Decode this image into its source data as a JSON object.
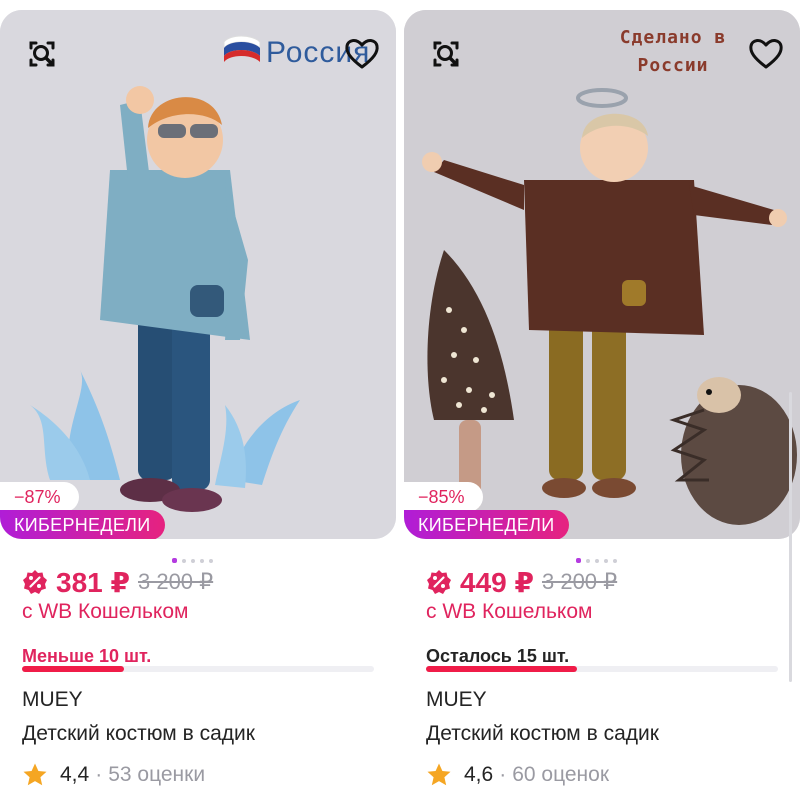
{
  "products": [
    {
      "discount": "−87%",
      "promo_label": "КИБЕРНЕДЕЛИ",
      "origin_logo": "Россия",
      "price": "381 ₽",
      "old_price": "3 200 ₽",
      "wallet_text": "с WB Кошельком",
      "stock_text": "Меньше 10 шт.",
      "stock_level": 0.29,
      "brand": "MUEY",
      "name": "Детский костюм в садик",
      "rating": "4,4",
      "reviews": "53 оценки",
      "gallery_total": 5,
      "gallery_active": 0
    },
    {
      "discount": "−85%",
      "promo_label": "КИБЕРНЕДЕЛИ",
      "origin_text": "Сделано в России",
      "origin_line1": "Сделано в",
      "origin_line2": "России",
      "price": "449 ₽",
      "old_price": "3 200 ₽",
      "wallet_text": "с WB Кошельком",
      "stock_text": "Осталось 15 шт.",
      "stock_level": 0.43,
      "brand": "MUEY",
      "name": "Детский костюм в садик",
      "rating": "4,6",
      "reviews": "60 оценок",
      "gallery_total": 5,
      "gallery_active": 0
    }
  ],
  "icons": {
    "similar": "image-search-icon",
    "favorite": "heart-icon",
    "price": "percent-badge-icon",
    "rating": "star-icon"
  },
  "colors": {
    "accent": "#e0245e",
    "promo_gradient_start": "#b01dd7",
    "promo_gradient_end": "#e6227f",
    "star": "#f5a623",
    "stock_bar": "#f01c48"
  }
}
